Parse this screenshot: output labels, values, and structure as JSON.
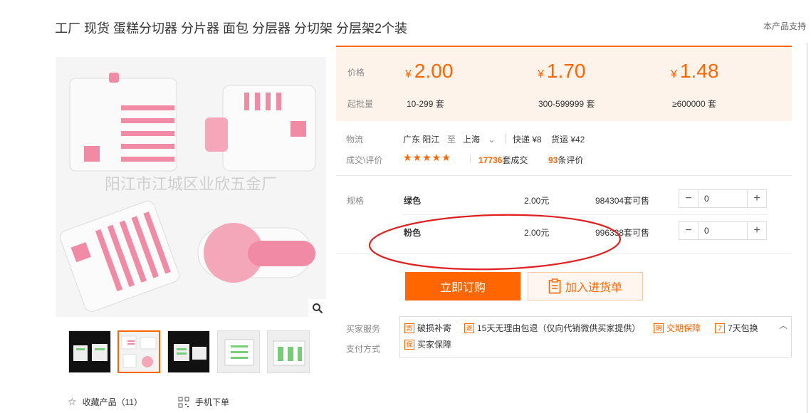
{
  "top_links": [
    "",
    "",
    "",
    "",
    "",
    ""
  ],
  "title": "工厂 现货 蛋糕分切器 分片器 面包 分层器 分切架 分层架2个装",
  "support_text": "本产品支持",
  "main_image": {
    "watermark": "阳江市江城区业欣五金厂"
  },
  "thumbnails": [
    {
      "variant": "dark"
    },
    {
      "variant": "light"
    },
    {
      "variant": "dark"
    },
    {
      "variant": "light"
    },
    {
      "variant": "light"
    }
  ],
  "footer": {
    "favorite_label": "收藏产品（11）",
    "mobile_label": "手机下单"
  },
  "price_panel": {
    "price_label": "价格",
    "moq_label": "起批量",
    "currency": "¥",
    "tiers": [
      {
        "price": "2.00",
        "range": "10-299 套"
      },
      {
        "price": "1.70",
        "range": "300-599999 套"
      },
      {
        "price": "1.48",
        "range": "≥600000 套"
      }
    ]
  },
  "logistics": {
    "label": "物流",
    "from": "广东 阳江",
    "to_word": "至",
    "to": "上海",
    "express": "快递 ¥8",
    "freight": "货运 ¥42"
  },
  "deals": {
    "label": "成交\\评价",
    "stars": "★★★★★",
    "count": "17736",
    "count_suffix": "套成交",
    "reviews": "93",
    "reviews_suffix": "条评价"
  },
  "specs": {
    "label": "规格",
    "rows": [
      {
        "name": "绿色",
        "price": "2.00元",
        "stock": "984304套可售",
        "qty": "0"
      },
      {
        "name": "粉色",
        "price": "2.00元",
        "stock": "996338套可售",
        "qty": "0"
      }
    ]
  },
  "actions": {
    "buy_now": "立即订购",
    "add_cart": "加入进货单"
  },
  "services": {
    "buyer_label": "买家服务",
    "pay_label": "支付方式",
    "items": [
      {
        "icon": "寄",
        "text": "破损补寄"
      },
      {
        "icon": "退",
        "text": "15天无理由包退（仅向代销微供买家提供）"
      },
      {
        "icon": "期",
        "text": "交期保障",
        "highlight": true
      },
      {
        "icon": "7",
        "text": "7天包换"
      }
    ],
    "guarantee": {
      "icon": "保",
      "text": "买家保障"
    }
  },
  "colors": {
    "accent": "#ff6600",
    "annotation": "#e02020"
  }
}
